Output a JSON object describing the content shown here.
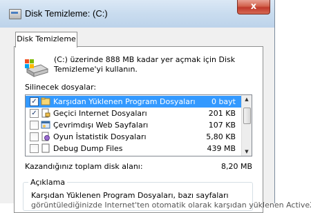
{
  "window": {
    "title": "Disk Temizleme:  (C:)",
    "close_glyph": "x"
  },
  "tabs": [
    {
      "label": "Disk Temizleme"
    }
  ],
  "description": "(C:) üzerinde 888 MB kadar yer açmak için Disk Temizleme'yi kullanın.",
  "files_label": "Silinecek dosyalar:",
  "files": [
    {
      "name": "Karşıdan Yüklenen Program Dosyaları",
      "size": "0 bayt",
      "checked": true,
      "selected": true,
      "icon": "folder-icon"
    },
    {
      "name": "Geçici Internet Dosyaları",
      "size": "201 KB",
      "checked": true,
      "selected": false,
      "icon": "document-lock-icon"
    },
    {
      "name": "Çevrimdışı Web Sayfaları",
      "size": "107 KB",
      "checked": false,
      "selected": false,
      "icon": "offline-page-icon"
    },
    {
      "name": "Oyun İstatistik Dosyaları",
      "size": "5,80 KB",
      "checked": false,
      "selected": false,
      "icon": "game-icon"
    },
    {
      "name": "Debug Dump Files",
      "size": "439 MB",
      "checked": false,
      "selected": false,
      "icon": "document-icon"
    }
  ],
  "total_label": "Kazandığınız toplam disk alanı:",
  "total_value": "8,20 MB",
  "description_group": {
    "title": "Açıklama",
    "text": "Karşıdan Yüklenen Program Dosyaları, bazı sayfaları",
    "text2": "görüntülediğinizde Internet'ten otomatik olarak karşıdan yüklenen ActiveX"
  }
}
